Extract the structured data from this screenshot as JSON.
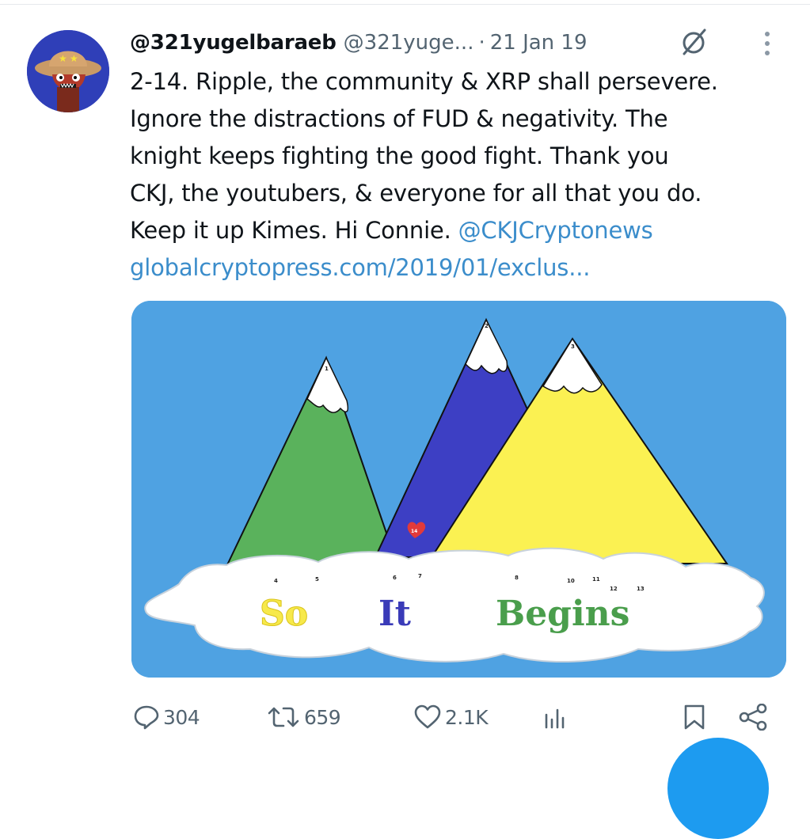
{
  "tweet": {
    "display_name": "@321yugelbaraeb",
    "handle": "@321yuge...",
    "separator": "·",
    "date": "21 Jan 19",
    "text_lines": [
      "2-14. Ripple, the community & XRP shall persevere.",
      "Ignore the distractions of FUD & negativity. The",
      "knight keeps fighting the good fight. Thank you",
      "CKJ, the youtubers, & everyone for all that you do."
    ],
    "line5_text": "Keep it up Kimes. Hi Connie. ",
    "mention": "@CKJCryptonews",
    "url": "globalcryptopress.com/2019/01/exclus..."
  },
  "media": {
    "words": [
      "So",
      "It",
      "Begins"
    ],
    "numbers": [
      "1",
      "2",
      "3",
      "4",
      "5",
      "6",
      "7",
      "8",
      "10",
      "11",
      "12",
      "13",
      "14"
    ],
    "colors": {
      "sky": "#4fa2e2",
      "green_mountain": "#5ab25c",
      "blue_mountain": "#3d3fc4",
      "yellow_mountain": "#fbf152",
      "heart": "#e23a3a"
    }
  },
  "actions": {
    "replies": "304",
    "reposts": "659",
    "likes": "2.1K"
  },
  "icons": [
    "avatar",
    "grok-icon",
    "more-icon",
    "reply-icon",
    "repost-icon",
    "like-icon",
    "views-icon",
    "bookmark-icon",
    "share-icon",
    "compose-fab"
  ],
  "colors": {
    "link": "#3b8dcb",
    "secondary_text": "#536471",
    "accent": "#1d9bf0"
  }
}
